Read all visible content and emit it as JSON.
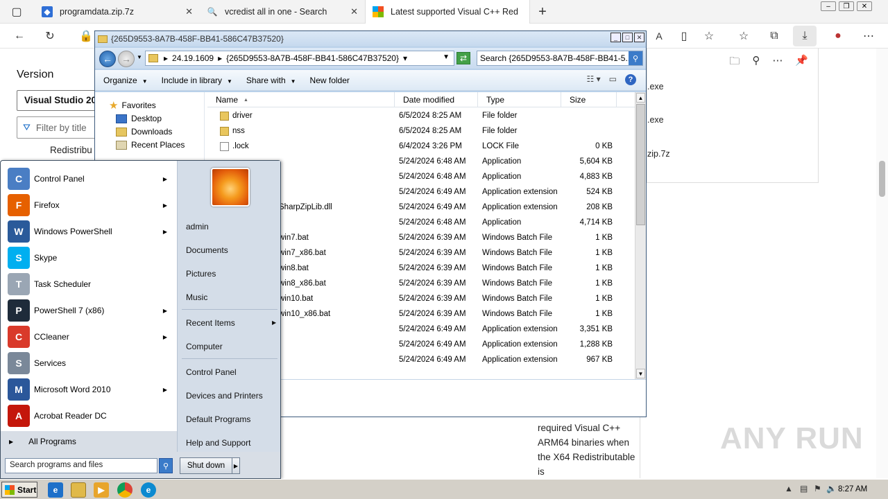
{
  "browser": {
    "tabs": [
      {
        "label": "programdata.zip.7z",
        "icon": "shield-icon"
      },
      {
        "label": "vcredist all in one - Search",
        "icon": "search-icon"
      },
      {
        "label": "Latest supported Visual C++ Red",
        "icon": "microsoft-icon"
      }
    ],
    "new_tab": "+",
    "page": {
      "version_label": "Version",
      "version_select": "Visual Studio 20",
      "filter_placeholder": "Filter by title",
      "redist_label": "Redistribu",
      "body_text": "required Visual C++ ARM64 binaries when the X64 Redistributable is"
    },
    "downloads": [
      {
        "name": ".exe"
      },
      {
        "name": ".exe"
      },
      {
        "name": "zip.7z"
      }
    ],
    "watermark": "ANY RUN"
  },
  "explorer": {
    "title": "{265D9553-8A7B-458F-BB41-586C47B37520}",
    "address": [
      "24.19.1609",
      "{265D9553-8A7B-458F-BB41-586C47B37520}"
    ],
    "search_placeholder": "Search {265D9553-8A7B-458F-BB41-5...",
    "commands": [
      "Organize",
      "Include in library",
      "Share with",
      "New folder"
    ],
    "nav": {
      "favorites": "Favorites",
      "items": [
        "Desktop",
        "Downloads",
        "Recent Places"
      ]
    },
    "columns": [
      "Name",
      "Date modified",
      "Type",
      "Size"
    ],
    "files": [
      {
        "name": "driver",
        "date": "6/5/2024 8:25 AM",
        "type": "File folder",
        "size": "",
        "kind": "folder"
      },
      {
        "name": "nss",
        "date": "6/5/2024 8:25 AM",
        "type": "File folder",
        "size": "",
        "kind": "folder"
      },
      {
        "name": ".lock",
        "date": "6/4/2024 3:26 PM",
        "type": "LOCK File",
        "size": "0 KB",
        "kind": "file"
      },
      {
        "name": "",
        "date": "5/24/2024 6:48 AM",
        "type": "Application",
        "size": "5,604 KB",
        "kind": "hidden"
      },
      {
        "name": "",
        "date": "5/24/2024 6:48 AM",
        "type": "Application",
        "size": "4,883 KB",
        "kind": "hidden"
      },
      {
        "name": "",
        "date": "5/24/2024 6:49 AM",
        "type": "Application extension",
        "size": "524 KB",
        "kind": "hidden"
      },
      {
        "name": "SharpZipLib.dll",
        "date": "5/24/2024 6:49 AM",
        "type": "Application extension",
        "size": "208 KB",
        "kind": "partial"
      },
      {
        "name": "",
        "date": "5/24/2024 6:48 AM",
        "type": "Application",
        "size": "4,714 KB",
        "kind": "hidden"
      },
      {
        "name": "win7.bat",
        "date": "5/24/2024 6:39 AM",
        "type": "Windows Batch File",
        "size": "1 KB",
        "kind": "partial"
      },
      {
        "name": "win7_x86.bat",
        "date": "5/24/2024 6:39 AM",
        "type": "Windows Batch File",
        "size": "1 KB",
        "kind": "partial"
      },
      {
        "name": "win8.bat",
        "date": "5/24/2024 6:39 AM",
        "type": "Windows Batch File",
        "size": "1 KB",
        "kind": "partial"
      },
      {
        "name": "win8_x86.bat",
        "date": "5/24/2024 6:39 AM",
        "type": "Windows Batch File",
        "size": "1 KB",
        "kind": "partial"
      },
      {
        "name": "win10.bat",
        "date": "5/24/2024 6:39 AM",
        "type": "Windows Batch File",
        "size": "1 KB",
        "kind": "partial"
      },
      {
        "name": "win10_x86.bat",
        "date": "5/24/2024 6:39 AM",
        "type": "Windows Batch File",
        "size": "1 KB",
        "kind": "partial"
      },
      {
        "name": "",
        "date": "5/24/2024 6:49 AM",
        "type": "Application extension",
        "size": "3,351 KB",
        "kind": "hidden"
      },
      {
        "name": "",
        "date": "5/24/2024 6:49 AM",
        "type": "Application extension",
        "size": "1,288 KB",
        "kind": "hidden"
      },
      {
        "name": "",
        "date": "5/24/2024 6:49 AM",
        "type": "Application extension",
        "size": "967 KB",
        "kind": "hidden"
      }
    ]
  },
  "startmenu": {
    "programs": [
      {
        "label": "Control Panel",
        "icon": "control-panel-icon",
        "color": "#4a7ec4",
        "submenu": true
      },
      {
        "label": "Firefox",
        "icon": "firefox-icon",
        "color": "#e66000",
        "submenu": true
      },
      {
        "label": "Windows PowerShell",
        "icon": "powershell-icon",
        "color": "#2a5a9a",
        "submenu": true
      },
      {
        "label": "Skype",
        "icon": "skype-icon",
        "color": "#00aff0",
        "submenu": false
      },
      {
        "label": "Task Scheduler",
        "icon": "clock-icon",
        "color": "#9aa6b4",
        "submenu": false
      },
      {
        "label": "PowerShell 7 (x86)",
        "icon": "powershell7-icon",
        "color": "#1e2b3a",
        "submenu": true
      },
      {
        "label": "CCleaner",
        "icon": "ccleaner-icon",
        "color": "#d93a2b",
        "submenu": true
      },
      {
        "label": "Services",
        "icon": "services-icon",
        "color": "#7a8899",
        "submenu": false
      },
      {
        "label": "Microsoft Word 2010",
        "icon": "word-icon",
        "color": "#2b579a",
        "submenu": true
      },
      {
        "label": "Acrobat Reader DC",
        "icon": "acrobat-icon",
        "color": "#c4170b",
        "submenu": false
      }
    ],
    "all_programs": "All Programs",
    "search_placeholder": "Search programs and files",
    "right": [
      "admin",
      "Documents",
      "Pictures",
      "Music",
      "Recent Items",
      "Computer",
      "Control Panel",
      "Devices and Printers",
      "Default Programs",
      "Help and Support"
    ],
    "shutdown": "Shut down"
  },
  "taskbar": {
    "start": "Start",
    "clock": "8:27 AM"
  }
}
